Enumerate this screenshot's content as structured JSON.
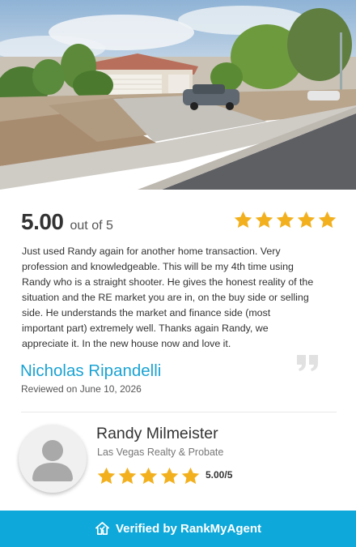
{
  "rating": {
    "score": "5.00",
    "out_of": "out of 5",
    "stars": 5
  },
  "review": {
    "text": "Just used Randy again for another home transaction. Very profession and knowledgeable. This will be my 4th time using Randy who is a straight shooter. He gives the honest reality of the situation and the RE market you are in, on the buy side or selling side. He understands the market and finance side (most important part) extremely well. Thanks again Randy, we appreciate it. In the new house now and love it.",
    "reviewer": "Nicholas Ripandelli",
    "reviewed_prefix": "Reviewed on",
    "reviewed_date": "June 10, 2026"
  },
  "agent": {
    "name": "Randy Milmeister",
    "company": "Las Vegas Realty & Probate",
    "stars": 5,
    "score": "5.00/5"
  },
  "footer": {
    "label": "Verified by RankMyAgent"
  },
  "colors": {
    "accent": "#0ea8da",
    "star": "#f2b01e",
    "name": "#1aa3d3"
  },
  "icons": {
    "star": "star-icon",
    "quote": "quote-icon",
    "avatar": "user-silhouette-icon",
    "brand": "rankmyagent-house-icon"
  }
}
